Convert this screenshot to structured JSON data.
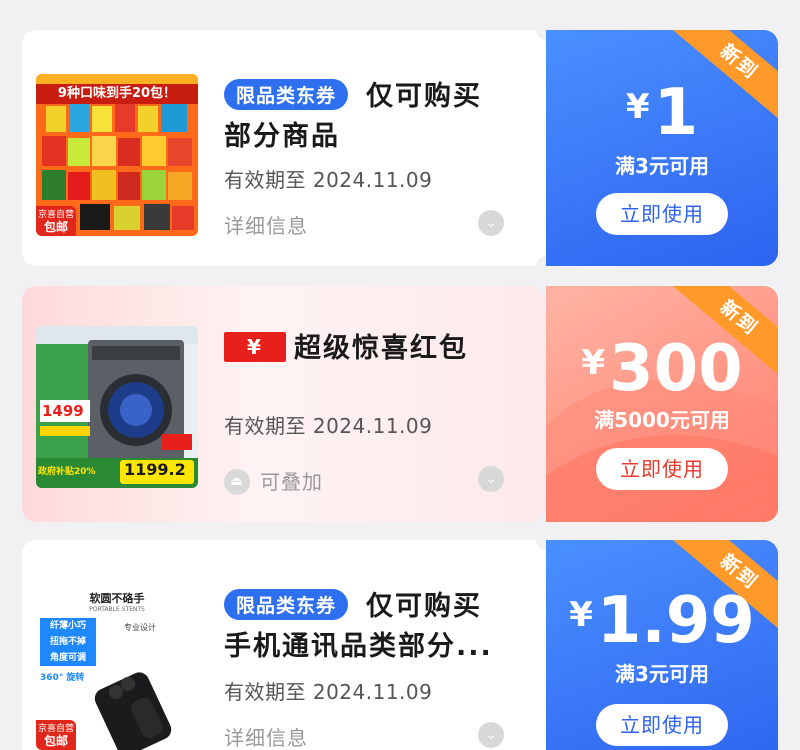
{
  "coupons": [
    {
      "tag": "限品类东券",
      "title_line1": "仅可购买",
      "title_line2": "部分商品",
      "expiry": "有效期至 2024.11.09",
      "detail_label": "详细信息",
      "currency": "¥",
      "amount": "1",
      "condition": "满3元可用",
      "use_label": "立即使用",
      "ribbon": "新到",
      "thumb_banner": "9种口味到手20包！",
      "thumb_badge_top": "京喜自营",
      "thumb_badge_bottom": "包邮"
    },
    {
      "red_tag": "¥",
      "title_line1": "超级惊喜红包",
      "expiry": "有效期至 2024.11.09",
      "stack_label": "可叠加",
      "currency": "¥",
      "amount": "300",
      "condition": "满5000元可用",
      "use_label": "立即使用",
      "ribbon": "新到",
      "thumb_price": "1499",
      "thumb_price2": "1199.2",
      "thumb_subsidy": "政府补贴20%"
    },
    {
      "tag": "限品类东券",
      "title_line1": "仅可购买",
      "title_line2": "手机通讯品类部分...",
      "expiry": "有效期至 2024.11.09",
      "detail_label": "详细信息",
      "currency": "¥",
      "amount": "1.99",
      "condition": "满3元可用",
      "use_label": "立即使用",
      "ribbon": "新到",
      "thumb_title": "软圆不硌手",
      "thumb_sub": "PORTABLE STENTS",
      "thumb_feature1": "纤薄小巧",
      "thumb_feature2": "扭拖不掉",
      "thumb_feature3": "角度可调",
      "thumb_feature4": "360° 旋转",
      "thumb_design": "专业设计",
      "thumb_badge_top": "京喜自营",
      "thumb_badge_bottom": "包邮"
    }
  ],
  "colors": {
    "blue_panel": "#2d63f0",
    "salmon_panel": "#ff7c6b",
    "ribbon": "#ff9a2a",
    "tag_blue": "#2e6ff0",
    "red_tag": "#e8201c"
  },
  "icons": {
    "chevron": "chevron-down-icon",
    "stack": "stack-icon"
  }
}
